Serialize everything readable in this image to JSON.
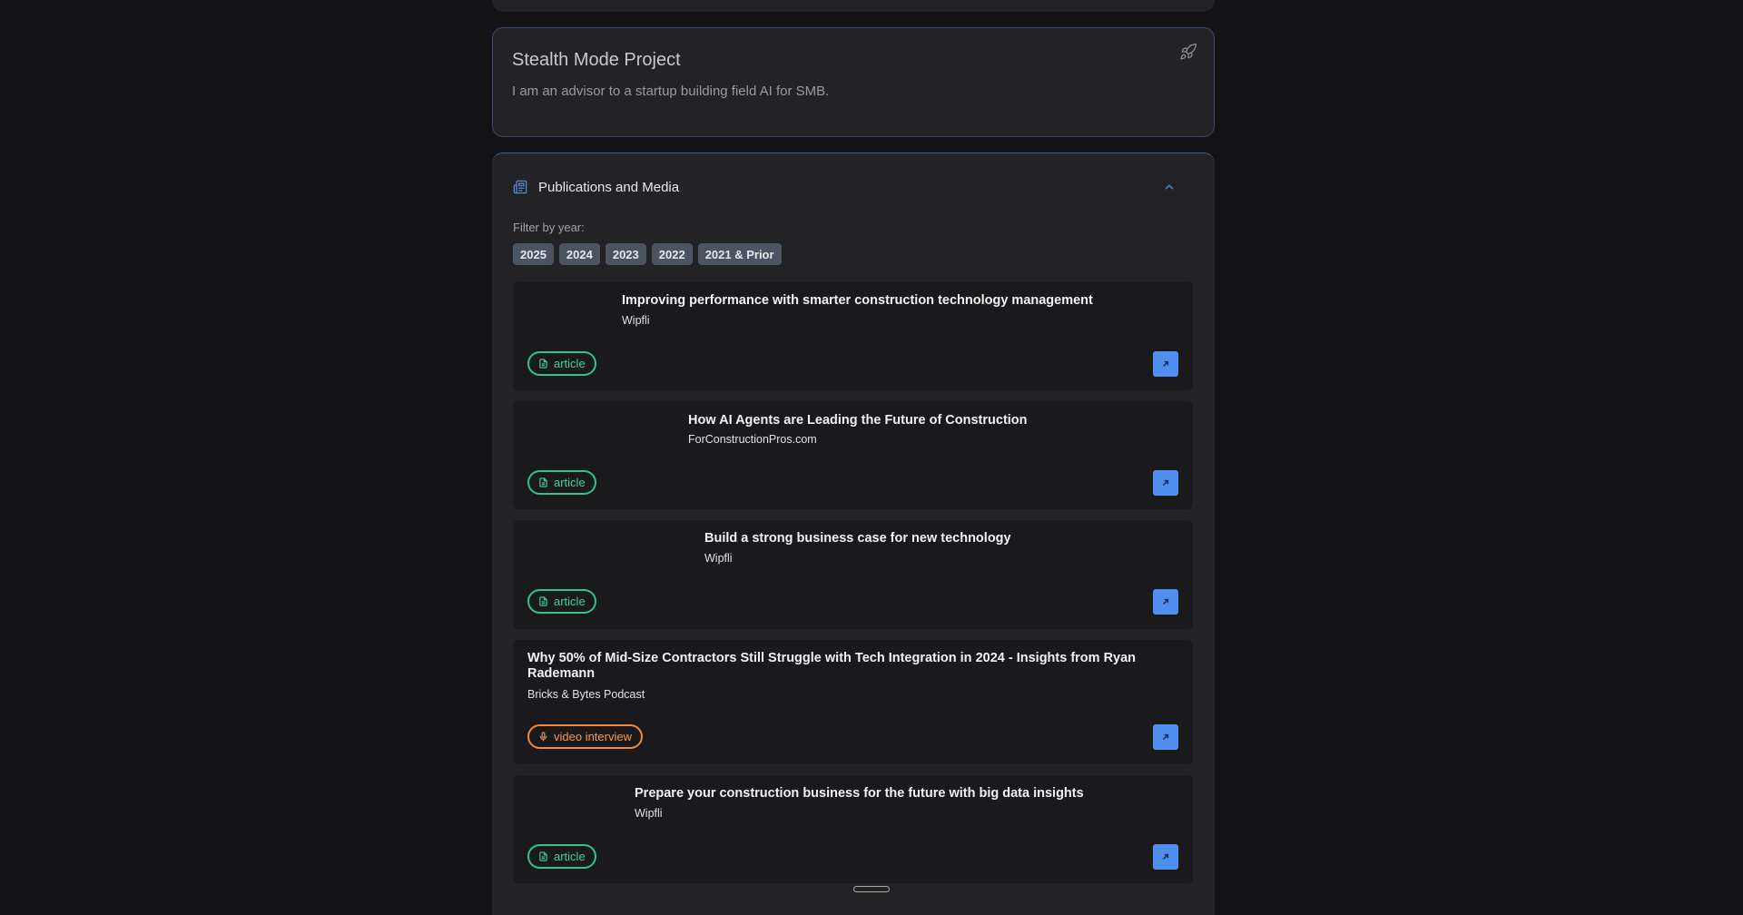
{
  "project": {
    "title": "Stealth Mode Project",
    "description": "I am an advisor to a startup building field AI for SMB."
  },
  "publications": {
    "title": "Publications and Media",
    "filter_label": "Filter by year:",
    "years": [
      "2025",
      "2024",
      "2023",
      "2022",
      "2021 & Prior"
    ],
    "items": [
      {
        "title": "Improving performance with smarter construction technology management",
        "source": "Wipfli",
        "type": "article"
      },
      {
        "title": "How AI Agents are Leading the Future of Construction",
        "source": "ForConstructionPros.com",
        "type": "article"
      },
      {
        "title": "Build a strong business case for new technology",
        "source": "Wipfli",
        "type": "article"
      },
      {
        "title": "Why 50% of Mid-Size Contractors Still Struggle with Tech Integration in 2024 - Insights from Ryan Rademann",
        "source": "Bricks & Bytes Podcast",
        "type": "video interview"
      },
      {
        "title": "Prepare your construction business for the future with big data insights",
        "source": "Wipfli",
        "type": "article"
      }
    ]
  },
  "colors": {
    "accent": "#4f8ff0",
    "article_badge": "#2fc48d",
    "video_badge": "#f08a3c"
  }
}
